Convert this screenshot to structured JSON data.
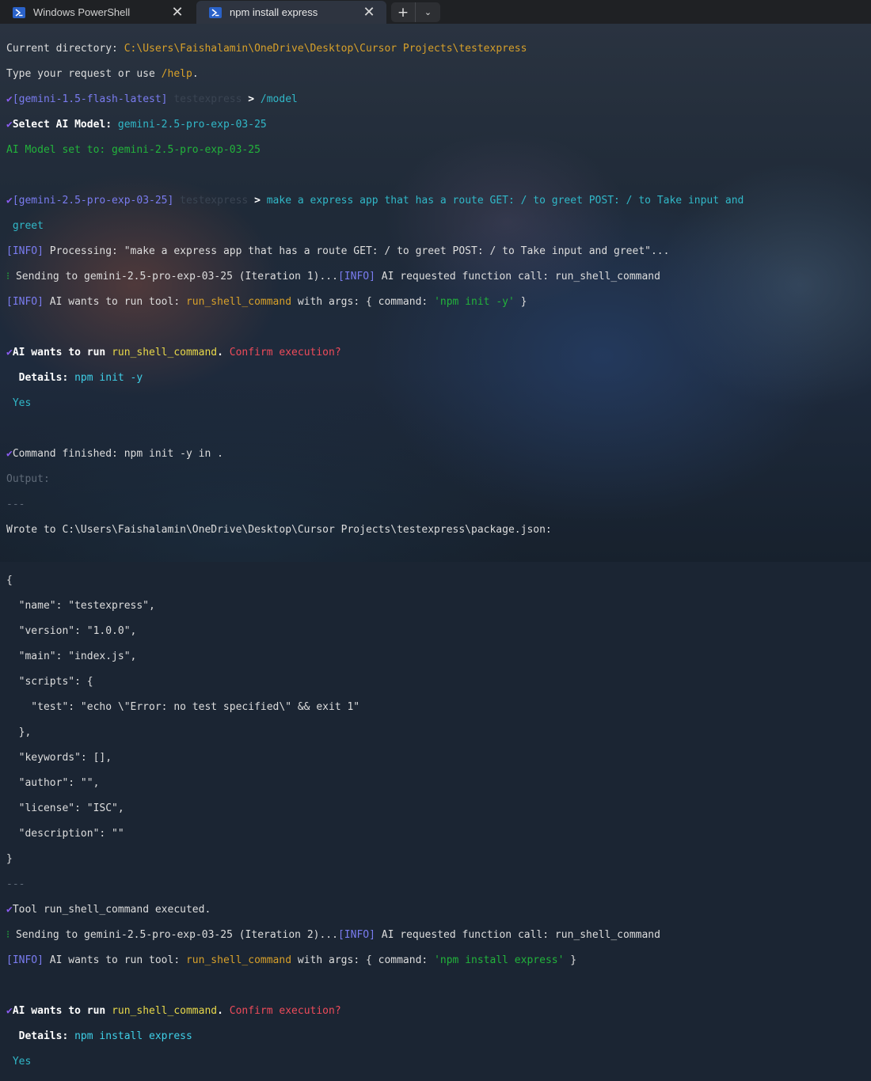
{
  "tabs": [
    {
      "label": "Windows PowerShell",
      "active": false
    },
    {
      "label": "npm install express",
      "active": true
    }
  ],
  "tabbar": {
    "new_tab": "+",
    "dropdown": "⌄",
    "close": "✕"
  },
  "colors": {
    "background": "#1e2a3c",
    "orange": "#d7a02a",
    "purple": "#7a7cf0",
    "cyan": "#31b8c8",
    "green": "#22b33b",
    "yellow": "#e8d84a",
    "red": "#ee4b5a"
  },
  "terminal": {
    "l1a": "Current directory: ",
    "l1b": "C:\\Users\\Faishalamin\\OneDrive\\Desktop\\Cursor Projects\\testexpress",
    "l2a": "Type your request or use ",
    "l2b": "/help",
    "l2c": ".",
    "check": "✔",
    "model_old": "[gemini-1.5-flash-latest]",
    "dir": "testexpress",
    "prompt": ">",
    "cmd_model": "/model",
    "select_label": "Select AI Model: ",
    "select_value": "gemini-2.5-pro-exp-03-25",
    "model_set": "AI Model set to: gemini-2.5-pro-exp-03-25",
    "model_new": "[gemini-2.5-pro-exp-03-25]",
    "request_a": "make a express app that has a route GET: / to greet POST: / to Take input and",
    "request_b": "greet",
    "info": "[INFO]",
    "processing": " Processing: \"make a express app that has a route GET: / to greet POST: / to Take input and greet\"...",
    "spinner": "⁝",
    "sending1": " Sending to gemini-2.5-pro-exp-03-25 (Iteration 1)...",
    "fncall": " AI requested function call: run_shell_command",
    "wants_a": " AI wants to run tool: ",
    "tool": "run_shell_command",
    "wants_b": " with args: { command: ",
    "arg1": "'npm init -y'",
    "wants_c": " }",
    "confirm_a": "AI wants to run ",
    "confirm_b": ".",
    "confirm_c": "Confirm execution?",
    "details_label": "Details: ",
    "details1": "npm init -y",
    "yes": "Yes",
    "finished": "Command finished: npm init -y in .",
    "output": "Output:",
    "sep": "---",
    "wrote": "Wrote to C:\\Users\\Faishalamin\\OneDrive\\Desktop\\Cursor Projects\\testexpress\\package.json:",
    "json": [
      "{",
      "  \"name\": \"testexpress\",",
      "  \"version\": \"1.0.0\",",
      "  \"main\": \"index.js\",",
      "  \"scripts\": {",
      "    \"test\": \"echo \\\"Error: no test specified\\\" && exit 1\"",
      "  },",
      "  \"keywords\": [],",
      "  \"author\": \"\",",
      "  \"license\": \"ISC\",",
      "  \"description\": \"\"",
      "}"
    ],
    "executed": "Tool run_shell_command executed.",
    "sending2": " Sending to gemini-2.5-pro-exp-03-25 (Iteration 2)...",
    "arg2": "'npm install express'",
    "details2": "npm install express"
  }
}
